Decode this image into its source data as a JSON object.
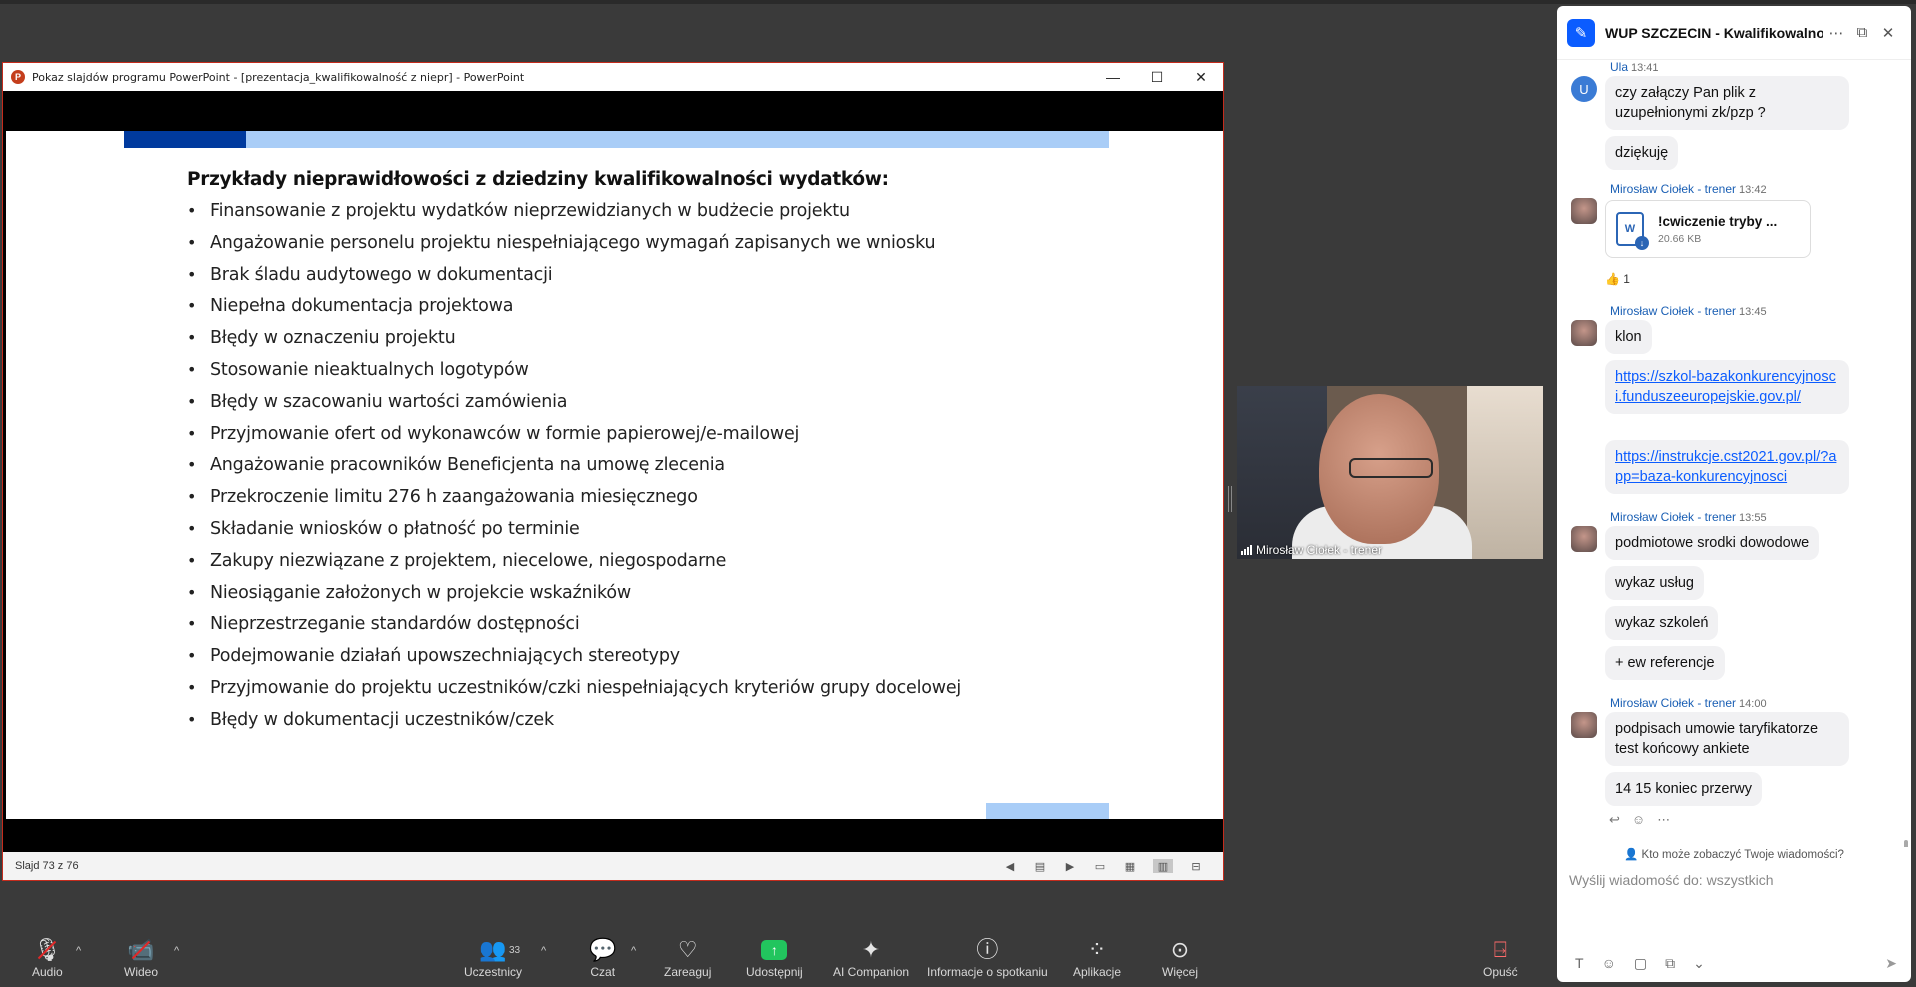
{
  "ppt": {
    "window_title": "Pokaz slajdów programu PowerPoint - [prezentacja_kwalifikowalność  z niepr] - PowerPoint",
    "app_icon": "P",
    "controls": {
      "minimize": "—",
      "maximize": "☐",
      "close": "✕"
    },
    "slide": {
      "heading": "Przykłady nieprawidłowości z dziedziny kwalifikowalności wydatków:",
      "bullets": [
        "Finansowanie z projektu wydatków nieprzewidzianych w budżecie projektu",
        "Angażowanie personelu projektu niespełniającego wymagań zapisanych we wniosku",
        "Brak śladu audytowego w dokumentacji",
        "Niepełna dokumentacja projektowa",
        "Błędy w oznaczeniu projektu",
        "Stosowanie nieaktualnych logotypów",
        "Błędy w szacowaniu wartości zamówienia",
        "Przyjmowanie ofert od wykonawców w formie papierowej/e-mailowej",
        "Angażowanie pracowników Beneficjenta na umowę zlecenia",
        "Przekroczenie limitu 276 h zaangażowania miesięcznego",
        "Składanie wniosków o płatność po terminie",
        "Zakupy niezwiązane z projektem, niecelowe, niegospodarne",
        "Nieosiąganie założonych w projekcie wskaźników",
        "Nieprzestrzeganie standardów dostępności",
        "Podejmowanie działań upowszechniających stereotypy",
        "Przyjmowanie do projektu uczestników/czki niespełniających kryteriów grupy docelowej",
        "Błędy w dokumentacji uczestników/czek"
      ]
    },
    "status": "Slajd 73 z 76"
  },
  "camera": {
    "name": "Mirosław Ciołek - trener"
  },
  "chat": {
    "title": "WUP SZCZECIN - Kwalifikowalno...",
    "messages": {
      "ula_meta": "Ula",
      "ula_time": "13:41",
      "ula_avatar": "U",
      "m1": "czy załączy Pan plik z uzupełnionymi zk/pzp ?",
      "m2": "dziękuję",
      "trener_name": "Mirosław Ciołek - trener",
      "t1_time": "13:42",
      "file_name": "!cwiczenie tryby ...",
      "file_size": "20.66 KB",
      "file_icon": "W",
      "reaction": "👍 1",
      "t2_time": "13:45",
      "m3": "klon",
      "link1": "https://szkol-bazakonkurencyjnosci.funduszeeuropejskie.gov.pl/",
      "link2": "https://instrukcje.cst2021.gov.pl/?app=baza-konkurencyjnosci",
      "t3_time": "13:55",
      "m4": "podmiotowe srodki dowodowe",
      "m5": "wykaz usług",
      "m6": "wykaz szkoleń",
      "m7": "+ ew referencje",
      "t4_time": "14:00",
      "m8": "podpisach umowie taryfikatorze test końcowy ankiete",
      "m9": "14 15 koniec przerwy"
    },
    "who_sees": "Kto może zobaczyć Twoje wiadomości?",
    "input_placeholder": "Wyślij wiadomość do: wszystkich"
  },
  "toolbar": {
    "audio": "Audio",
    "video": "Wideo",
    "participants": "Uczestnicy",
    "participants_count": "33",
    "chat": "Czat",
    "react": "Zareaguj",
    "share": "Udostępnij",
    "ai": "AI Companion",
    "info": "Informacje o spotkaniu",
    "apps": "Aplikacje",
    "more": "Więcej",
    "leave": "Opuść"
  },
  "colors": {
    "slide_bar_dark": "#003a9e",
    "slide_bar_light": "#a9cdf7",
    "zoom_blue": "#0b5cff",
    "share_green": "#22c55e",
    "close_red": "#c42b1c"
  }
}
